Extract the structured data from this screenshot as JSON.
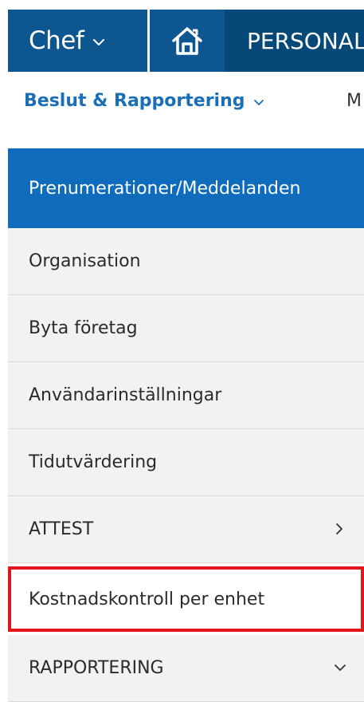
{
  "topbar": {
    "role_label": "Chef",
    "person_label": "PERSONAL"
  },
  "subnav": {
    "main_label": "Beslut & Rapportering",
    "next_label": "M"
  },
  "menu": {
    "items": [
      {
        "label": "Prenumerationer/Meddelanden"
      },
      {
        "label": "Organisation"
      },
      {
        "label": "Byta företag"
      },
      {
        "label": "Användarinställningar"
      },
      {
        "label": "Tidutvärdering"
      },
      {
        "label": "ATTEST"
      },
      {
        "label": "Kostnadskontroll per enhet"
      },
      {
        "label": "RAPPORTERING"
      }
    ]
  },
  "colors": {
    "topbar_bg": "#0d5690",
    "topbar_active_bg": "#064878",
    "accent_blue": "#1a6fb7",
    "active_item_bg": "#0f6cbd",
    "highlight_border": "#e3141a",
    "item_bg": "#f2f2f2"
  },
  "icons": {
    "role_chevron": "chevron-down-icon",
    "home": "home-icon",
    "subnav_chevron": "chevron-down-icon",
    "attest_chevron": "chevron-right-icon",
    "rapportering_chevron": "chevron-down-icon"
  }
}
